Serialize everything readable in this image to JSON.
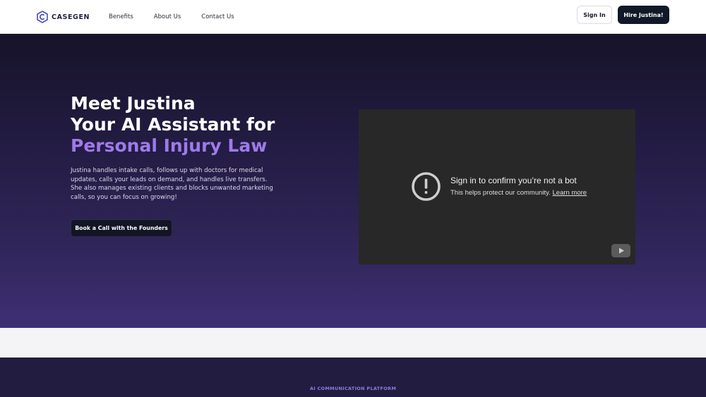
{
  "header": {
    "logo_text": "CASEGEN",
    "nav": [
      "Benefits",
      "About Us",
      "Contact Us"
    ],
    "signin_label": "Sign In",
    "hire_label": "Hire Justina!"
  },
  "hero": {
    "title_line1": "Meet Justina",
    "title_line2": "Your AI Assistant for",
    "title_accent": "Personal Injury Law",
    "description": "Justina handles intake calls, follows up with doctors for medical updates, calls your leads on demand, and handles live transfers. She also manages existing clients and blocks unwanted marketing calls, so you can focus on growing!",
    "cta_label": "Book a Call with the Founders"
  },
  "video": {
    "title": "Sign in to confirm you’re not a bot",
    "subtitle": "This helps protect our community.",
    "link_label": "Learn more",
    "icon": "warning-circle-icon"
  },
  "section2": {
    "eyebrow": "AI COMMUNICATION PLATFORM"
  },
  "colors": {
    "accent": "#9f7aea",
    "dark_button": "#111827",
    "hero_top": "#171329",
    "hero_bottom": "#3e2f74"
  }
}
